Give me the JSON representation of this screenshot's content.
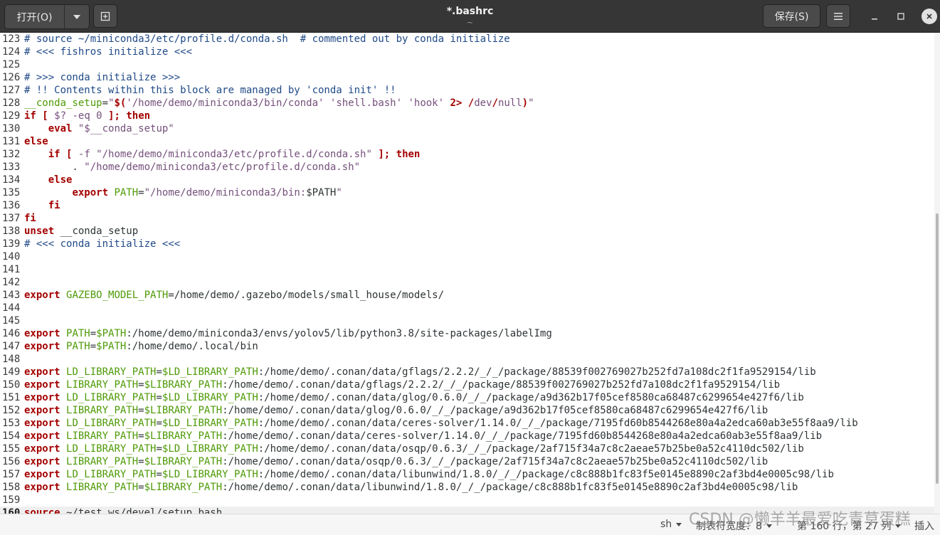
{
  "header": {
    "open_label": "打开(O)",
    "title": "*.bashrc",
    "subtitle": "~",
    "save_label": "保存(S)"
  },
  "colors": {
    "keyword": "#a40000",
    "variable": "#4e9a06",
    "string": "#75507b",
    "comment": "#204a87",
    "header_bg": "#363636"
  },
  "editor": {
    "current_line": "160",
    "lines": [
      {
        "n": "123",
        "t": [
          [
            "com",
            "# source ~/miniconda3/etc/profile.d/conda.sh  # commented out by conda initialize"
          ]
        ]
      },
      {
        "n": "124",
        "t": [
          [
            "com",
            "# <<< fishros initialize <<<"
          ]
        ]
      },
      {
        "n": "125",
        "t": []
      },
      {
        "n": "126",
        "t": [
          [
            "com",
            "# >>> conda initialize >>>"
          ]
        ]
      },
      {
        "n": "127",
        "t": [
          [
            "com",
            "# !! Contents within this block are managed by 'conda init' !!"
          ]
        ]
      },
      {
        "n": "128",
        "t": [
          [
            "var",
            "__conda_setup"
          ],
          [
            "nm",
            "="
          ],
          [
            "str",
            "\""
          ],
          [
            "kw",
            "$("
          ],
          [
            "str",
            "'/home/demo/miniconda3/bin/conda' 'shell.bash' 'hook'"
          ],
          [
            "nm",
            " "
          ],
          [
            "kw",
            "2>"
          ],
          [
            "nm",
            " "
          ],
          [
            "kw",
            "/"
          ],
          [
            "str",
            "dev"
          ],
          [
            "kw",
            "/"
          ],
          [
            "str",
            "null"
          ],
          [
            "kw",
            ")"
          ],
          [
            "str",
            "\""
          ]
        ]
      },
      {
        "n": "129",
        "t": [
          [
            "kw",
            "if"
          ],
          [
            "nm",
            " "
          ],
          [
            "kw",
            "["
          ],
          [
            "nm",
            " "
          ],
          [
            "str",
            "$? -eq 0"
          ],
          [
            "nm",
            " "
          ],
          [
            "kw",
            "];"
          ],
          [
            "nm",
            " "
          ],
          [
            "kw",
            "then"
          ]
        ]
      },
      {
        "n": "130",
        "t": [
          [
            "nm",
            "    "
          ],
          [
            "kw",
            "eval"
          ],
          [
            "nm",
            " "
          ],
          [
            "str",
            "\"$__conda_setup\""
          ]
        ]
      },
      {
        "n": "131",
        "t": [
          [
            "kw",
            "else"
          ]
        ]
      },
      {
        "n": "132",
        "t": [
          [
            "nm",
            "    "
          ],
          [
            "kw",
            "if"
          ],
          [
            "nm",
            " "
          ],
          [
            "kw",
            "["
          ],
          [
            "nm",
            " "
          ],
          [
            "str",
            "-f \"/home/demo/miniconda3/etc/profile.d/conda.sh\""
          ],
          [
            "nm",
            " "
          ],
          [
            "kw",
            "];"
          ],
          [
            "nm",
            " "
          ],
          [
            "kw",
            "then"
          ]
        ]
      },
      {
        "n": "133",
        "t": [
          [
            "nm",
            "        . "
          ],
          [
            "str",
            "\"/home/demo/miniconda3/etc/profile.d/conda.sh\""
          ]
        ]
      },
      {
        "n": "134",
        "t": [
          [
            "nm",
            "    "
          ],
          [
            "kw",
            "else"
          ]
        ]
      },
      {
        "n": "135",
        "t": [
          [
            "nm",
            "        "
          ],
          [
            "kw",
            "export"
          ],
          [
            "nm",
            " "
          ],
          [
            "var",
            "PATH"
          ],
          [
            "nm",
            "="
          ],
          [
            "str",
            "\"/home/demo/miniconda3/bin:"
          ],
          [
            "nm",
            "$PATH"
          ],
          [
            "str",
            "\""
          ]
        ]
      },
      {
        "n": "136",
        "t": [
          [
            "nm",
            "    "
          ],
          [
            "kw",
            "fi"
          ]
        ]
      },
      {
        "n": "137",
        "t": [
          [
            "kw",
            "fi"
          ]
        ]
      },
      {
        "n": "138",
        "t": [
          [
            "kw",
            "unset"
          ],
          [
            "nm",
            " __conda_setup"
          ]
        ]
      },
      {
        "n": "139",
        "t": [
          [
            "com",
            "# <<< conda initialize <<<"
          ]
        ]
      },
      {
        "n": "140",
        "t": []
      },
      {
        "n": "141",
        "t": []
      },
      {
        "n": "142",
        "t": []
      },
      {
        "n": "143",
        "t": [
          [
            "kw",
            "export"
          ],
          [
            "nm",
            " "
          ],
          [
            "var",
            "GAZEBO_MODEL_PATH"
          ],
          [
            "nm",
            "=/home/demo/.gazebo/models/small_house/models/"
          ]
        ]
      },
      {
        "n": "144",
        "t": []
      },
      {
        "n": "145",
        "t": []
      },
      {
        "n": "146",
        "t": [
          [
            "kw",
            "export"
          ],
          [
            "nm",
            " "
          ],
          [
            "var",
            "PATH"
          ],
          [
            "nm",
            "="
          ],
          [
            "var",
            "$PATH"
          ],
          [
            "nm",
            ":/home/demo/miniconda3/envs/yolov5/lib/python3.8/site-packages/labelImg"
          ]
        ]
      },
      {
        "n": "147",
        "t": [
          [
            "kw",
            "export"
          ],
          [
            "nm",
            " "
          ],
          [
            "var",
            "PATH"
          ],
          [
            "nm",
            "="
          ],
          [
            "var",
            "$PATH"
          ],
          [
            "nm",
            ":/home/demo/.local/bin"
          ]
        ]
      },
      {
        "n": "148",
        "t": []
      },
      {
        "n": "149",
        "t": [
          [
            "kw",
            "export"
          ],
          [
            "nm",
            " "
          ],
          [
            "var",
            "LD_LIBRARY_PATH"
          ],
          [
            "nm",
            "="
          ],
          [
            "var",
            "$LD_LIBRARY_PATH"
          ],
          [
            "nm",
            ":/home/demo/.conan/data/gflags/2.2.2/_/_/package/88539f002769027b252fd7a108dc2f1fa9529154/lib"
          ]
        ]
      },
      {
        "n": "150",
        "t": [
          [
            "kw",
            "export"
          ],
          [
            "nm",
            " "
          ],
          [
            "var",
            "LIBRARY_PATH"
          ],
          [
            "nm",
            "="
          ],
          [
            "var",
            "$LIBRARY_PATH"
          ],
          [
            "nm",
            ":/home/demo/.conan/data/gflags/2.2.2/_/_/package/88539f002769027b252fd7a108dc2f1fa9529154/lib"
          ]
        ]
      },
      {
        "n": "151",
        "t": [
          [
            "kw",
            "export"
          ],
          [
            "nm",
            " "
          ],
          [
            "var",
            "LD_LIBRARY_PATH"
          ],
          [
            "nm",
            "="
          ],
          [
            "var",
            "$LD_LIBRARY_PATH"
          ],
          [
            "nm",
            ":/home/demo/.conan/data/glog/0.6.0/_/_/package/a9d362b17f05cef8580ca68487c6299654e427f6/lib"
          ]
        ]
      },
      {
        "n": "152",
        "t": [
          [
            "kw",
            "export"
          ],
          [
            "nm",
            " "
          ],
          [
            "var",
            "LIBRARY_PATH"
          ],
          [
            "nm",
            "="
          ],
          [
            "var",
            "$LIBRARY_PATH"
          ],
          [
            "nm",
            ":/home/demo/.conan/data/glog/0.6.0/_/_/package/a9d362b17f05cef8580ca68487c6299654e427f6/lib"
          ]
        ]
      },
      {
        "n": "153",
        "t": [
          [
            "kw",
            "export"
          ],
          [
            "nm",
            " "
          ],
          [
            "var",
            "LD_LIBRARY_PATH"
          ],
          [
            "nm",
            "="
          ],
          [
            "var",
            "$LD_LIBRARY_PATH"
          ],
          [
            "nm",
            ":/home/demo/.conan/data/ceres-solver/1.14.0/_/_/package/7195fd60b8544268e80a4a2edca60ab3e55f8aa9/lib"
          ]
        ]
      },
      {
        "n": "154",
        "t": [
          [
            "kw",
            "export"
          ],
          [
            "nm",
            " "
          ],
          [
            "var",
            "LIBRARY_PATH"
          ],
          [
            "nm",
            "="
          ],
          [
            "var",
            "$LIBRARY_PATH"
          ],
          [
            "nm",
            ":/home/demo/.conan/data/ceres-solver/1.14.0/_/_/package/7195fd60b8544268e80a4a2edca60ab3e55f8aa9/lib"
          ]
        ]
      },
      {
        "n": "155",
        "t": [
          [
            "kw",
            "export"
          ],
          [
            "nm",
            " "
          ],
          [
            "var",
            "LD_LIBRARY_PATH"
          ],
          [
            "nm",
            "="
          ],
          [
            "var",
            "$LD_LIBRARY_PATH"
          ],
          [
            "nm",
            ":/home/demo/.conan/data/osqp/0.6.3/_/_/package/2af715f34a7c8c2aeae57b25be0a52c4110dc502/lib"
          ]
        ]
      },
      {
        "n": "156",
        "t": [
          [
            "kw",
            "export"
          ],
          [
            "nm",
            " "
          ],
          [
            "var",
            "LIBRARY_PATH"
          ],
          [
            "nm",
            "="
          ],
          [
            "var",
            "$LIBRARY_PATH"
          ],
          [
            "nm",
            ":/home/demo/.conan/data/osqp/0.6.3/_/_/package/2af715f34a7c8c2aeae57b25be0a52c4110dc502/lib"
          ]
        ]
      },
      {
        "n": "157",
        "t": [
          [
            "kw",
            "export"
          ],
          [
            "nm",
            " "
          ],
          [
            "var",
            "LD_LIBRARY_PATH"
          ],
          [
            "nm",
            "="
          ],
          [
            "var",
            "$LD_LIBRARY_PATH"
          ],
          [
            "nm",
            ":/home/demo/.conan/data/libunwind/1.8.0/_/_/package/c8c888b1fc83f5e0145e8890c2af3bd4e0005c98/lib"
          ]
        ]
      },
      {
        "n": "158",
        "t": [
          [
            "kw",
            "export"
          ],
          [
            "nm",
            " "
          ],
          [
            "var",
            "LIBRARY_PATH"
          ],
          [
            "nm",
            "="
          ],
          [
            "var",
            "$LIBRARY_PATH"
          ],
          [
            "nm",
            ":/home/demo/.conan/data/libunwind/1.8.0/_/_/package/c8c888b1fc83f5e0145e8890c2af3bd4e0005c98/lib"
          ]
        ]
      },
      {
        "n": "159",
        "t": []
      },
      {
        "n": "160",
        "t": [
          [
            "kw",
            "source"
          ],
          [
            "nm",
            " ~/test_ws/devel/setup.bash"
          ]
        ]
      }
    ]
  },
  "statusbar": {
    "language": "sh",
    "tab_width": "制表符宽度：8",
    "position": "第 160 行，第 27 列",
    "mode": "插入"
  },
  "watermark": "CSDN @懒羊羊最爱吃青草蛋糕"
}
